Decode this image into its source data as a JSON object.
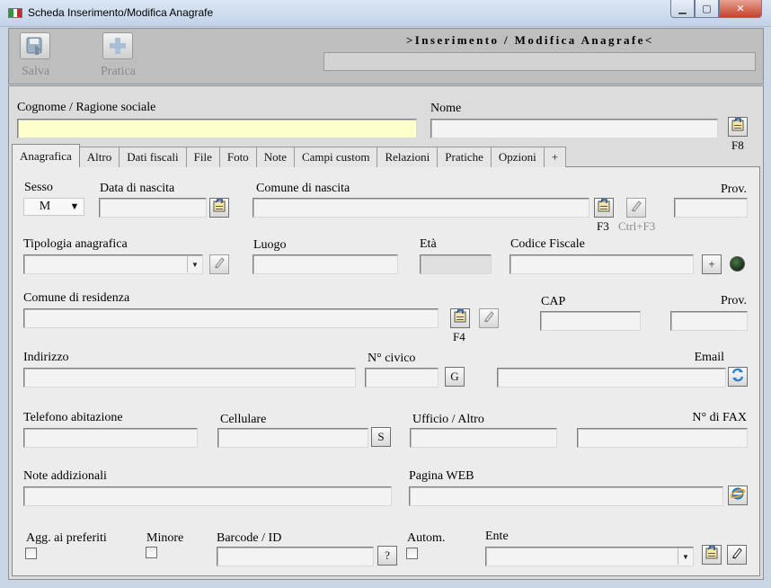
{
  "window": {
    "title": "Scheda Inserimento/Modifica Anagrafe",
    "controls": {
      "minimize": "▁",
      "maximize": "▢",
      "close": "✕"
    }
  },
  "toolbar": {
    "save_label": "Salva",
    "pratica_label": "Pratica",
    "heading": ">Inserimento / Modifica Anagrafe<",
    "status_text": ""
  },
  "header": {
    "cognome_label": "Cognome / Ragione sociale",
    "cognome_value": "",
    "nome_label": "Nome",
    "nome_value": "",
    "f8_hint": "F8"
  },
  "tabs": [
    "Anagrafica",
    "Altro",
    "Dati fiscali",
    "File",
    "Foto",
    "Note",
    "Campi custom",
    "Relazioni",
    "Pratiche",
    "Opzioni",
    "+"
  ],
  "form": {
    "sesso_label": "Sesso",
    "sesso_value": "M",
    "data_nascita_label": "Data di nascita",
    "data_nascita_value": "",
    "comune_nascita_label": "Comune di nascita",
    "comune_nascita_value": "",
    "f3_hint": "F3",
    "ctrl_f3_hint": "Ctrl+F3",
    "prov_label": "Prov.",
    "prov_nascita_value": "",
    "tipologia_label": "Tipologia anagrafica",
    "tipologia_value": "",
    "luogo_label": "Luogo",
    "luogo_value": "",
    "eta_label": "Età",
    "eta_value": "",
    "cf_label": "Codice Fiscale",
    "cf_value": "",
    "cf_add": "+",
    "comune_residenza_label": "Comune di residenza",
    "comune_residenza_value": "",
    "f4_hint": "F4",
    "cap_label": "CAP",
    "cap_value": "",
    "prov_res_label": "Prov.",
    "prov_res_value": "",
    "indirizzo_label": "Indirizzo",
    "indirizzo_value": "",
    "civico_label": "N° civico",
    "civico_value": "",
    "g_button": "G",
    "email_label": "Email",
    "email_value": "",
    "telefono_label": "Telefono abitazione",
    "telefono_value": "",
    "cellulare_label": "Cellulare",
    "cellulare_value": "",
    "s_button": "S",
    "ufficio_label": "Ufficio / Altro",
    "ufficio_value": "",
    "fax_label": "N° di FAX",
    "fax_value": "",
    "note_label": "Note addizionali",
    "note_value": "",
    "web_label": "Pagina WEB",
    "web_value": "",
    "preferiti_label": "Agg. ai preferiti",
    "minore_label": "Minore",
    "barcode_label": "Barcode / ID",
    "barcode_value": "",
    "help_button": "?",
    "autom_label": "Autom.",
    "ente_label": "Ente",
    "ente_value": ""
  },
  "icons": {
    "save": "floppy-icon",
    "pratica": "plus-icon",
    "lookup": "address-book-icon",
    "edit": "pencil-icon",
    "refresh": "refresh-icon",
    "browser": "globe-icon"
  },
  "colors": {
    "required_field": "#ffffcc",
    "panel": "#ececec",
    "toolbar": "#bebebe"
  }
}
